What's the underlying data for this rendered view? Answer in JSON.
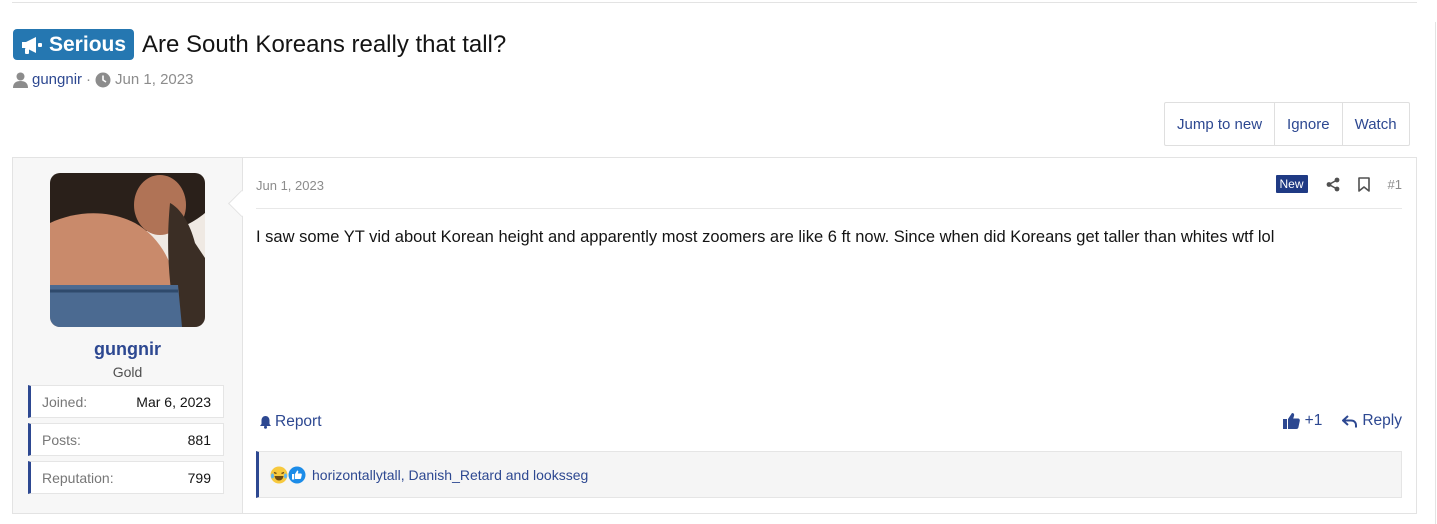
{
  "thread": {
    "prefix_label": "Serious",
    "title": "Are South Koreans really that tall?",
    "author": "gungnir",
    "separator": "·",
    "date": "Jun 1, 2023"
  },
  "thread_actions": {
    "jump_to_new": "Jump to new",
    "ignore": "Ignore",
    "watch": "Watch"
  },
  "post": {
    "user": {
      "name": "gungnir",
      "title": "Gold",
      "stats": [
        {
          "label": "Joined:",
          "value": "Mar 6, 2023"
        },
        {
          "label": "Posts:",
          "value": "881"
        },
        {
          "label": "Reputation:",
          "value": "799"
        }
      ]
    },
    "date": "Jun 1, 2023",
    "new_badge": "New",
    "post_number": "#1",
    "body": "I saw some YT vid about Korean height and apparently most zoomers are like 6 ft now. Since when did Koreans get taller than whites wtf lol",
    "report_label": "Report",
    "like_label": "+1",
    "reply_label": "Reply",
    "reactions_text": "horizontallytall, Danish_Retard and looksseg"
  },
  "icons": {
    "prefix": "megaphone-icon",
    "author": "user-icon",
    "date": "clock-icon",
    "share": "share-icon",
    "bookmark": "bookmark-icon",
    "report": "bell-icon",
    "like": "thumbs-up-icon",
    "reply": "reply-arrow-icon",
    "reactions": [
      "crying-laughing-emoji-icon",
      "like-reaction-icon"
    ]
  },
  "colors": {
    "link": "#2d4891",
    "prefix_bg": "#2577b1",
    "new_badge_bg": "#1f3a84",
    "muted": "#8c8c8c"
  }
}
